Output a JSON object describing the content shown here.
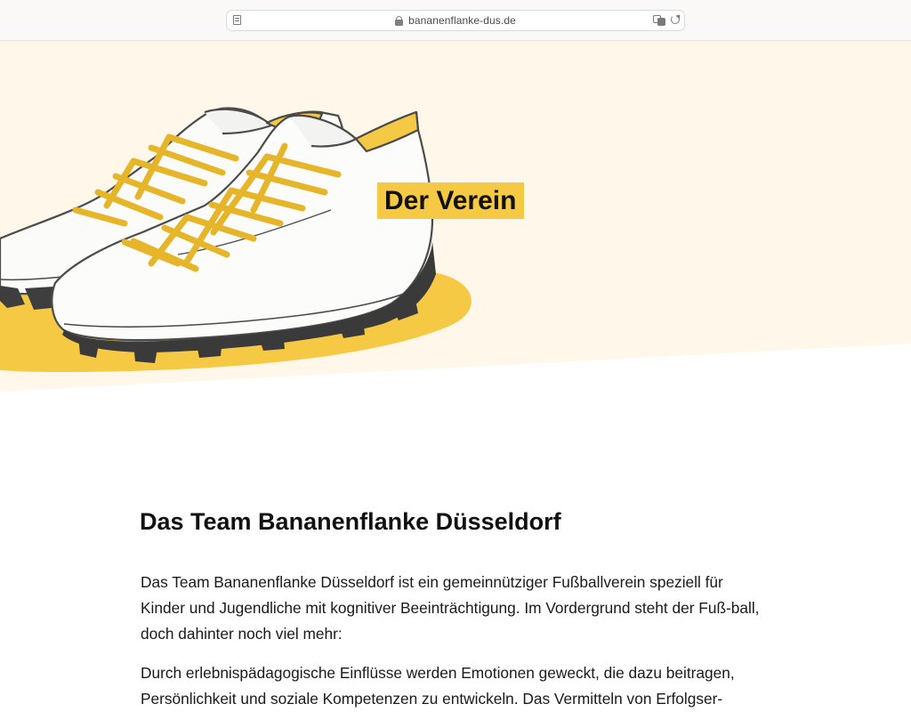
{
  "browser": {
    "url": "bananenflanke-dus.de"
  },
  "hero": {
    "title": "Der Verein"
  },
  "main": {
    "heading": "Das Team Bananenflanke Düsseldorf",
    "paragraphs": [
      "Das Team Bananenflanke Düsseldorf ist ein gemeinnütziger Fußballverein speziell für Kinder und Jugendliche mit kognitiver Beeinträchtigung. Im Vordergrund steht der Fuß-ball, doch dahinter noch viel mehr:",
      "Durch erlebnispädagogische Einflüsse werden Emotionen geweckt, die dazu beitragen, Persönlichkeit und soziale Kompetenzen zu entwickeln. Das Vermitteln von Erfolgser-"
    ]
  },
  "colors": {
    "accent_yellow": "#f6c944",
    "hero_background": "#fff7ea",
    "text": "#111111"
  }
}
